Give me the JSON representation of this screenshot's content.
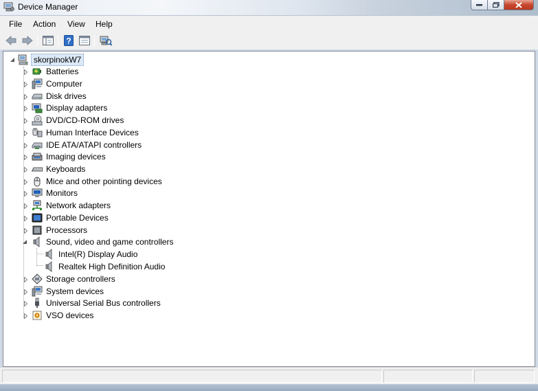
{
  "window": {
    "title": "Device Manager",
    "title_icon": "device-manager-icon"
  },
  "menu": [
    "File",
    "Action",
    "View",
    "Help"
  ],
  "toolbar": {
    "icons": [
      "back-arrow-icon",
      "forward-arrow-icon",
      "console-tree-icon",
      "help-icon",
      "properties-icon",
      "scan-hardware-icon"
    ]
  },
  "tree": {
    "root": {
      "label": "skorpinokW7",
      "icon": "computer-icon",
      "expanded": true
    },
    "categories": [
      {
        "label": "Batteries",
        "icon": "battery-icon"
      },
      {
        "label": "Computer",
        "icon": "computer-icon"
      },
      {
        "label": "Disk drives",
        "icon": "disk-drive-icon"
      },
      {
        "label": "Display adapters",
        "icon": "display-adapter-icon"
      },
      {
        "label": "DVD/CD-ROM drives",
        "icon": "dvd-drive-icon"
      },
      {
        "label": "Human Interface Devices",
        "icon": "hid-icon"
      },
      {
        "label": "IDE ATA/ATAPI controllers",
        "icon": "ide-controller-icon"
      },
      {
        "label": "Imaging devices",
        "icon": "camera-icon"
      },
      {
        "label": "Keyboards",
        "icon": "keyboard-icon"
      },
      {
        "label": "Mice and other pointing devices",
        "icon": "mouse-icon"
      },
      {
        "label": "Monitors",
        "icon": "monitor-icon"
      },
      {
        "label": "Network adapters",
        "icon": "network-icon"
      },
      {
        "label": "Portable Devices",
        "icon": "portable-device-icon"
      },
      {
        "label": "Processors",
        "icon": "processor-icon"
      },
      {
        "label": "Sound, video and game controllers",
        "icon": "speaker-icon",
        "expanded": true,
        "children": [
          {
            "label": "Intel(R) Display Audio",
            "icon": "speaker-icon"
          },
          {
            "label": "Realtek High Definition Audio",
            "icon": "speaker-icon"
          }
        ]
      },
      {
        "label": "Storage controllers",
        "icon": "storage-controller-icon"
      },
      {
        "label": "System devices",
        "icon": "system-device-icon"
      },
      {
        "label": "Universal Serial Bus controllers",
        "icon": "usb-icon"
      },
      {
        "label": "VSO devices",
        "icon": "vso-device-icon"
      }
    ]
  },
  "colors": {
    "selection_bg": "#dce9f6",
    "window_bg": "#f0f0f0",
    "close_button": "#c7462d"
  }
}
